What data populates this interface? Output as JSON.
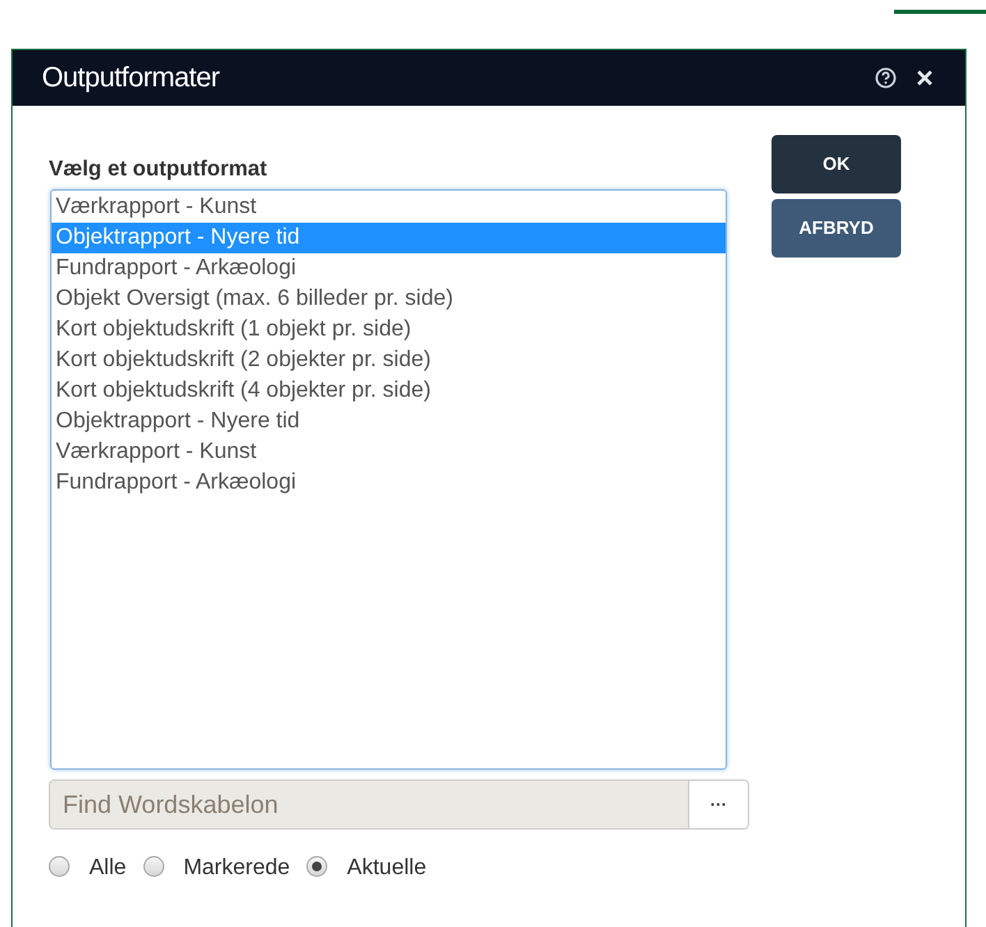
{
  "window": {
    "title": "Outputformater"
  },
  "prompt": "Vælg et outputformat",
  "formats": [
    {
      "label": "Værkrapport - Kunst",
      "selected": false
    },
    {
      "label": "Objektrapport - Nyere tid",
      "selected": true
    },
    {
      "label": "Fundrapport - Arkæologi",
      "selected": false
    },
    {
      "label": "Objekt Oversigt (max. 6 billeder pr. side)",
      "selected": false
    },
    {
      "label": "Kort objektudskrift (1 objekt pr. side)",
      "selected": false
    },
    {
      "label": "Kort objektudskrift (2 objekter pr. side)",
      "selected": false
    },
    {
      "label": "Kort objektudskrift (4 objekter pr. side)",
      "selected": false
    },
    {
      "label": "Objektrapport - Nyere tid",
      "selected": false
    },
    {
      "label": "Værkrapport - Kunst",
      "selected": false
    },
    {
      "label": "Fundrapport - Arkæologi",
      "selected": false
    }
  ],
  "template_field": {
    "placeholder": "Find Wordskabelon",
    "browse_label": "···"
  },
  "scope": [
    {
      "label": "Alle",
      "selected": false
    },
    {
      "label": "Markerede",
      "selected": false
    },
    {
      "label": "Aktuelle",
      "selected": true
    }
  ],
  "buttons": [
    {
      "label": "OK",
      "kind": "primary"
    },
    {
      "label": "AFBRYD",
      "kind": "secondary"
    }
  ]
}
